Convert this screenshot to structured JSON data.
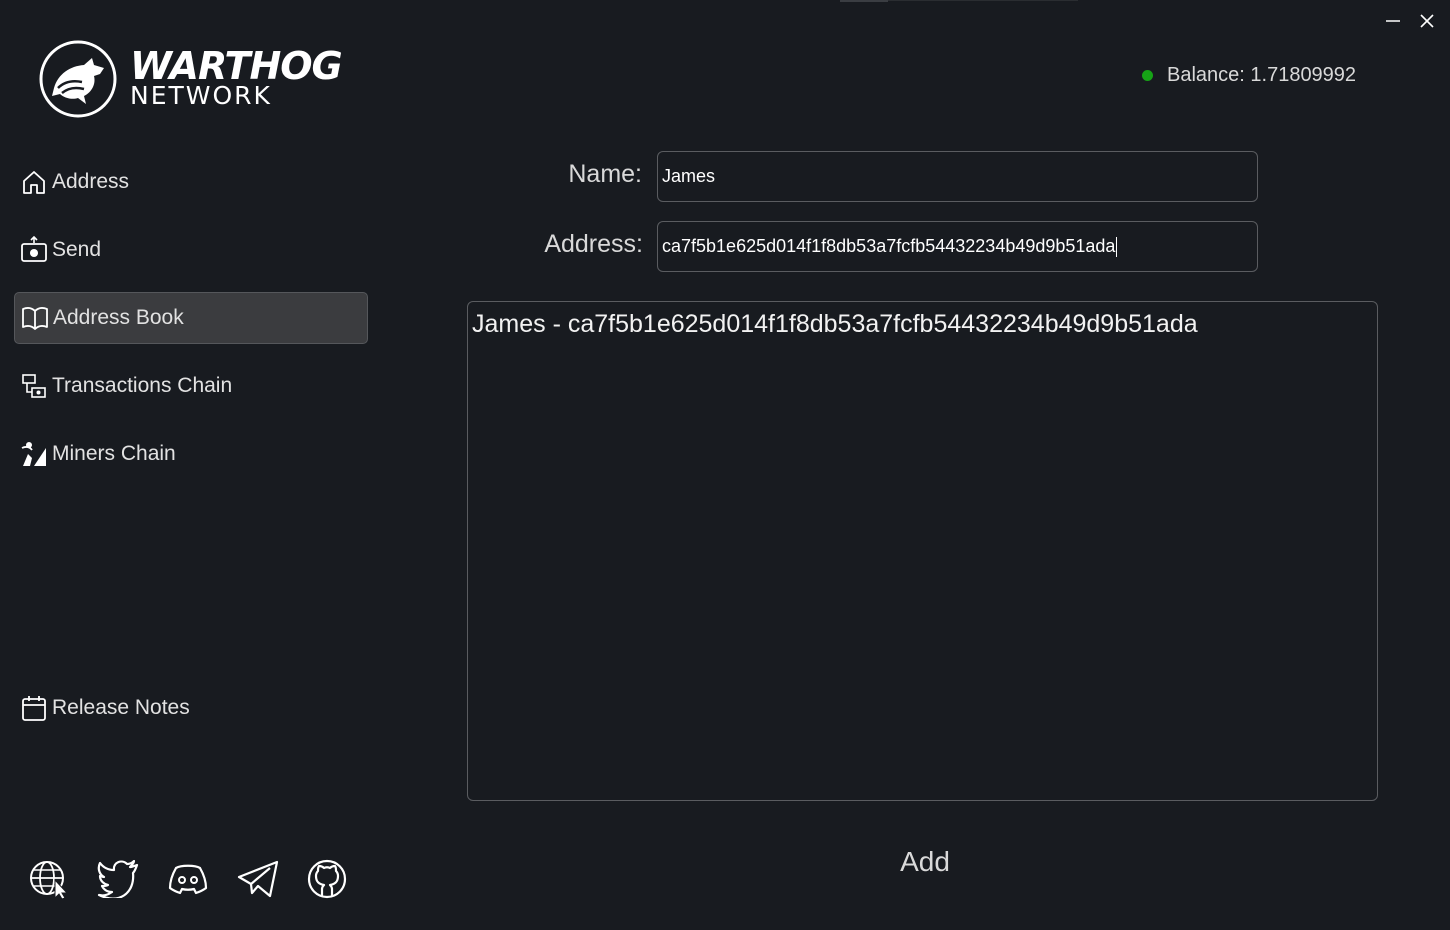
{
  "logo": {
    "word1": "WARTHOG",
    "word2": "NETWORK"
  },
  "balance": {
    "text": "Balance: 1.71809992",
    "status_color": "#16a316"
  },
  "sidebar": {
    "items": [
      {
        "label": "Address",
        "icon": "home-icon"
      },
      {
        "label": "Send",
        "icon": "send-icon"
      },
      {
        "label": "Address Book",
        "icon": "book-icon",
        "active": true
      },
      {
        "label": "Transactions Chain",
        "icon": "transactions-chain-icon"
      },
      {
        "label": "Miners Chain",
        "icon": "miner-icon"
      }
    ],
    "release_notes": "Release Notes"
  },
  "form": {
    "name_label": "Name:",
    "name_value": "James",
    "address_label": "Address:",
    "address_value": "ca7f5b1e625d014f1f8db53a7fcfb54432234b49d9b51ada"
  },
  "entries": [
    "James - ca7f5b1e625d014f1f8db53a7fcfb54432234b49d9b51ada"
  ],
  "add_label": "Add",
  "socials": [
    "globe-icon",
    "twitter-icon",
    "discord-icon",
    "telegram-icon",
    "github-icon"
  ]
}
